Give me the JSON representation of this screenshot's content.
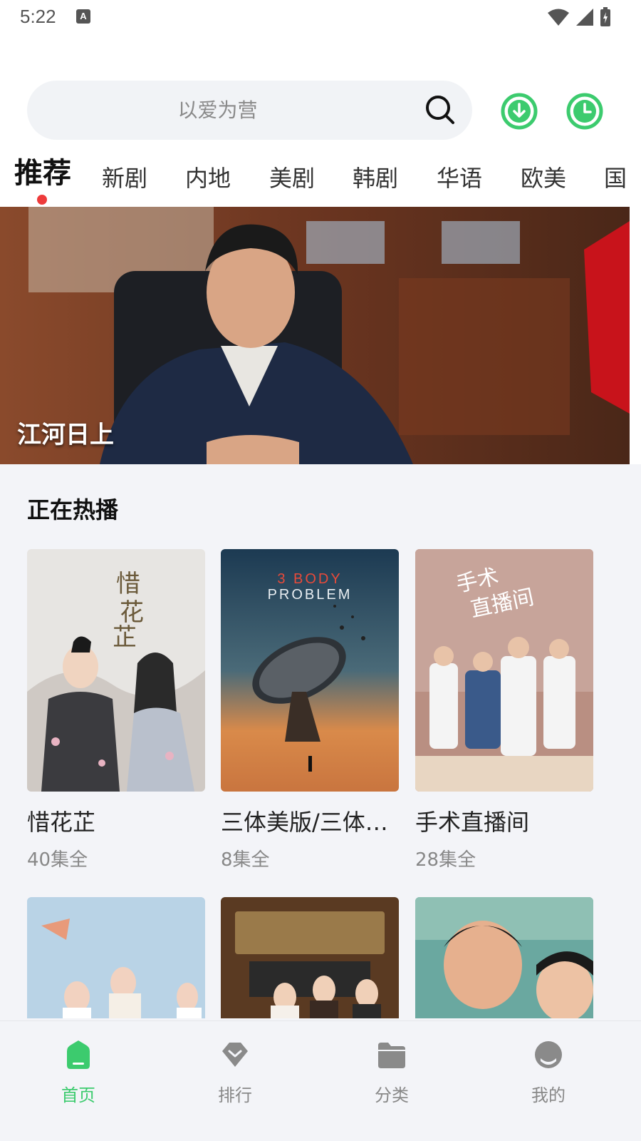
{
  "status_bar": {
    "time": "5:22",
    "notification_icon": "A"
  },
  "search": {
    "placeholder": "以爱为营",
    "download_icon": "download-icon",
    "history_icon": "history-clock-icon",
    "accent_color": "#3ccb6e"
  },
  "tabs": [
    {
      "label": "推荐",
      "active": true
    },
    {
      "label": "新剧"
    },
    {
      "label": "内地"
    },
    {
      "label": "美剧"
    },
    {
      "label": "韩剧"
    },
    {
      "label": "华语"
    },
    {
      "label": "欧美"
    },
    {
      "label": "国"
    }
  ],
  "banner": {
    "title": "江河日上"
  },
  "section": {
    "title": "正在热播",
    "cards": [
      {
        "title": "惜花芷",
        "episodes": "40集全"
      },
      {
        "title": "三体美版/三体…",
        "episodes": "8集全"
      },
      {
        "title": "手术直播间",
        "episodes": "28集全"
      }
    ]
  },
  "bottom_nav": [
    {
      "label": "首页",
      "icon": "home-icon",
      "active": true
    },
    {
      "label": "排行",
      "icon": "ranking-icon"
    },
    {
      "label": "分类",
      "icon": "folder-icon"
    },
    {
      "label": "我的",
      "icon": "profile-icon"
    }
  ]
}
